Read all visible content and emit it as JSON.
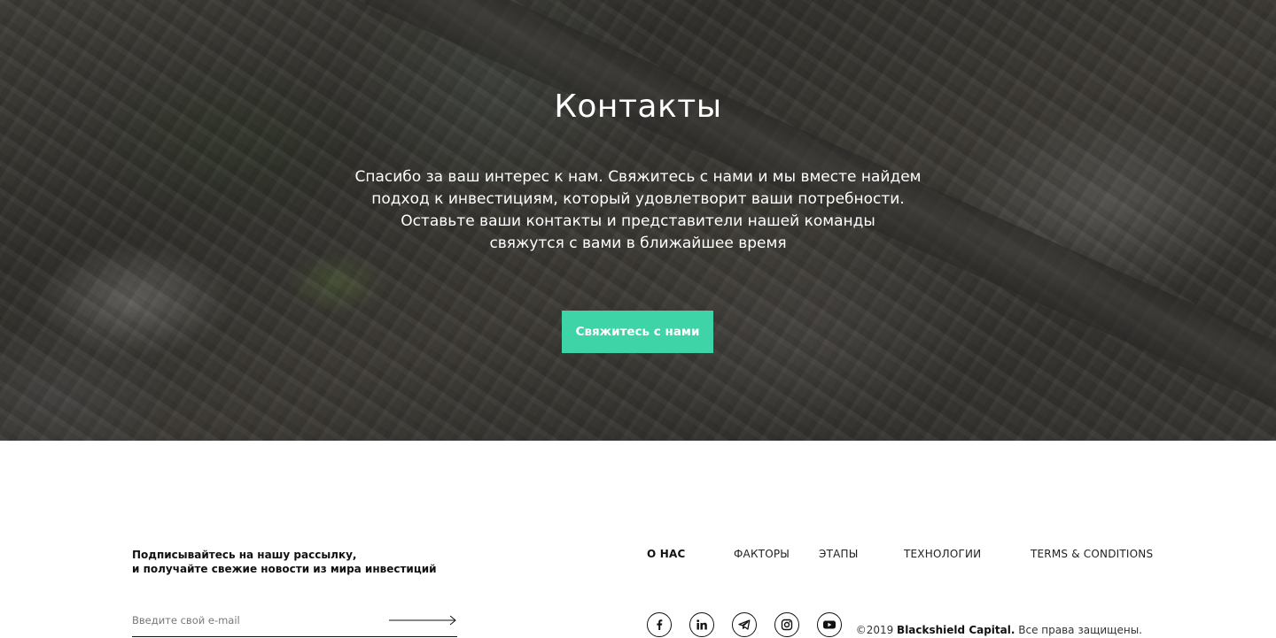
{
  "hero": {
    "title": "Контакты",
    "text_lines": [
      "Спасибо за ваш интерес к нам. Свяжитесь с нами и мы вместе найдем",
      "подход к инвестициям, который удовлетворит ваши потребности.",
      "Оставьте ваши контакты и представители нашей команды",
      "свяжутся с вами в ближайшее время"
    ],
    "button_label": "Свяжитесь с нами",
    "button_color": "#3fd3a8"
  },
  "subscribe": {
    "line1": "Подписывайтесь на нашу рассылку,",
    "line2": "и получайте свежие новости из мира инвестиций",
    "email_placeholder": "Введите свой e-mail",
    "submit_icon": "arrow-right-icon"
  },
  "nav": {
    "items": [
      {
        "label": "О НАС",
        "active": true
      },
      {
        "label": "ФАКТОРЫ",
        "active": false
      },
      {
        "label": "ЭТАПЫ",
        "active": false
      },
      {
        "label": "ТЕХНОЛОГИИ",
        "active": false
      },
      {
        "label": "TERMS & CONDITIONS",
        "active": false
      }
    ]
  },
  "socials": [
    {
      "name": "facebook-icon"
    },
    {
      "name": "linkedin-icon"
    },
    {
      "name": "telegram-icon"
    },
    {
      "name": "instagram-icon"
    },
    {
      "name": "youtube-icon"
    }
  ],
  "copyright": {
    "prefix": "©2019 ",
    "brand": "Blackshield Capital.",
    "suffix": " Все права защищены."
  }
}
